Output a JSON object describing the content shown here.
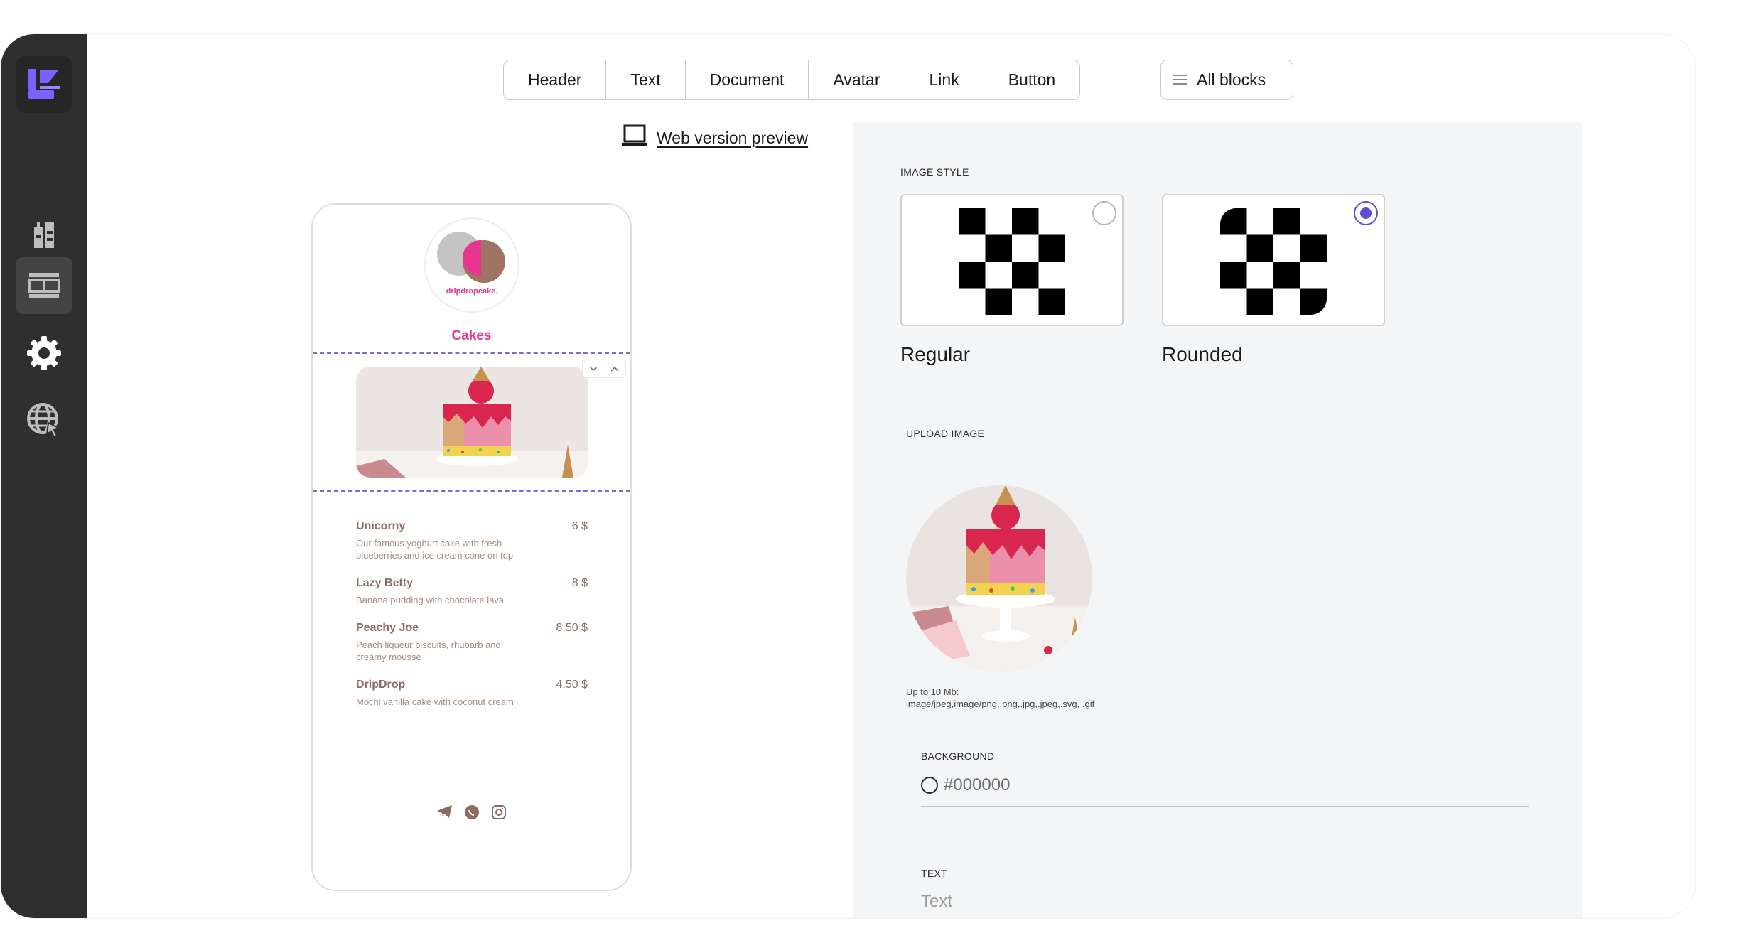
{
  "toolbar": {
    "tabs": [
      "Header",
      "Text",
      "Document",
      "Avatar",
      "Link",
      "Button"
    ],
    "all_blocks": "All blocks"
  },
  "web_preview": "Web version preview",
  "phone": {
    "brand": "dripdropcake.",
    "title": "Cakes",
    "menu": [
      {
        "name": "Unicorny",
        "price": "6 $",
        "desc": "Our famous yoghurt cake with fresh blueberries and ice cream cone on top"
      },
      {
        "name": "Lazy Betty",
        "price": "8 $",
        "desc": "Banana pudding with chocolate lava"
      },
      {
        "name": "Peachy Joe",
        "price": "8.50 $",
        "desc": "Peach liqueur biscuits, rhubarb and creamy mousse"
      },
      {
        "name": "DripDrop",
        "price": "4.50 $",
        "desc": "Mochi vanilla cake with coconut cream"
      }
    ]
  },
  "panel": {
    "image_style_label": "IMAGE STYLE",
    "styles": [
      {
        "name": "Regular",
        "selected": false
      },
      {
        "name": "Rounded",
        "selected": true
      }
    ],
    "upload_label": "UPLOAD IMAGE",
    "upload_note_1": "Up to 10 Mb:",
    "upload_note_2": "image/jpeg,image/png,.png,.jpg,.jpeg,.svg, .gif",
    "background_label": "BACKGROUND",
    "background_value": "#000000",
    "text_label": "TEXT",
    "text_placeholder": "Text"
  },
  "colors": {
    "accent": "#5b4fd0",
    "brand_pink": "#e8358f",
    "sidebar": "#2f2f2f",
    "panel_bg": "#f4f5f7"
  },
  "icons": {
    "sidebar": [
      "app-logo-icon",
      "blocks-icon",
      "layout-icon",
      "settings-gear-icon",
      "globe-icon"
    ],
    "social": [
      "telegram-icon",
      "whatsapp-icon",
      "instagram-icon"
    ]
  }
}
